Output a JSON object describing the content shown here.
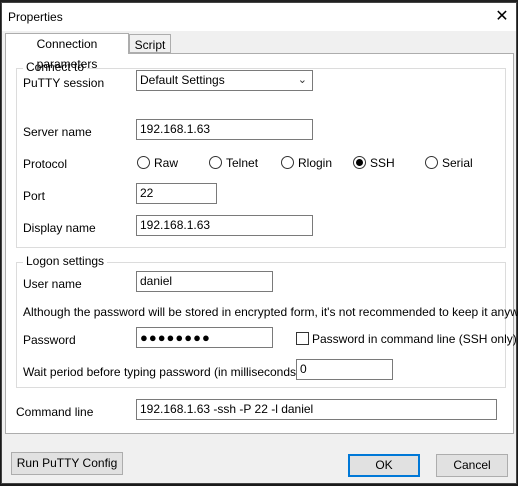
{
  "window": {
    "title": "Properties",
    "close_glyph": "✕"
  },
  "tabs": [
    {
      "label": "Connection parameters",
      "active": true
    },
    {
      "label": "Script",
      "active": false
    }
  ],
  "connect": {
    "legend": "Connect to",
    "session_label": "PuTTY session",
    "session_value": "Default Settings",
    "server_label": "Server name",
    "server_value": "192.168.1.63",
    "protocol_label": "Protocol",
    "protocols": [
      {
        "label": "Raw",
        "selected": false
      },
      {
        "label": "Telnet",
        "selected": false
      },
      {
        "label": "Rlogin",
        "selected": false
      },
      {
        "label": "SSH",
        "selected": true
      },
      {
        "label": "Serial",
        "selected": false
      }
    ],
    "port_label": "Port",
    "port_value": "22",
    "display_label": "Display name",
    "display_value": "192.168.1.63"
  },
  "logon": {
    "legend": "Logon settings",
    "user_label": "User name",
    "user_value": "daniel",
    "warning": "Although the password will be stored in encrypted form, it's not recommended to keep it anyway.",
    "password_label": "Password",
    "password_mask": "●●●●●●●●",
    "password_in_cmdline_label": "Password in command line (SSH only)",
    "password_in_cmdline_checked": false,
    "wait_label": "Wait period before typing password (in milliseconds)",
    "wait_value": "0"
  },
  "command": {
    "label": "Command line",
    "value": "192.168.1.63 -ssh -P 22 -l daniel"
  },
  "buttons": {
    "run_config": "Run PuTTY Config",
    "ok": "OK",
    "cancel": "Cancel"
  }
}
